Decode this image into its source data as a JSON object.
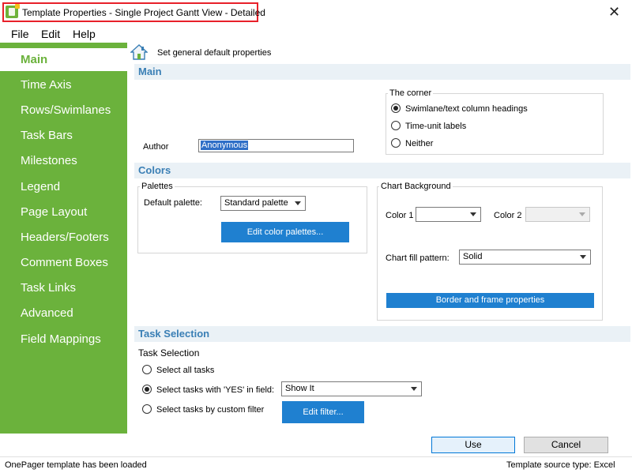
{
  "window": {
    "title": "Template Properties - Single Project Gantt View - Detailed",
    "close_glyph": "✕"
  },
  "menu": [
    "File",
    "Edit",
    "Help"
  ],
  "sidebar": {
    "items": [
      {
        "label": "Main",
        "active": true
      },
      {
        "label": "Time Axis"
      },
      {
        "label": "Rows/Swimlanes"
      },
      {
        "label": "Task Bars"
      },
      {
        "label": "Milestones"
      },
      {
        "label": "Legend"
      },
      {
        "label": "Page Layout"
      },
      {
        "label": "Headers/Footers"
      },
      {
        "label": "Comment Boxes"
      },
      {
        "label": "Task Links"
      },
      {
        "label": "Advanced"
      },
      {
        "label": "Field Mappings"
      }
    ]
  },
  "page_header": {
    "icon": "home-icon",
    "text": "Set general default properties"
  },
  "main_section": {
    "title": "Main",
    "author_label": "Author",
    "author_value": "Anonymous",
    "corner": {
      "title": "The corner",
      "options": [
        {
          "label": "Swimlane/text column headings",
          "checked": true
        },
        {
          "label": "Time-unit labels",
          "checked": false
        },
        {
          "label": "Neither",
          "checked": false
        }
      ]
    }
  },
  "colors_section": {
    "title": "Colors",
    "palettes": {
      "title": "Palettes",
      "default_palette_label": "Default palette:",
      "default_palette_value": "Standard palette",
      "edit_button": "Edit color palettes..."
    },
    "chart_background": {
      "title": "Chart Background",
      "color1_label": "Color 1",
      "color2_label": "Color 2",
      "fill_pattern_label": "Chart fill pattern:",
      "fill_pattern_value": "Solid",
      "border_button": "Border and frame properties"
    }
  },
  "task_selection_section": {
    "title": "Task Selection",
    "subtitle": "Task Selection",
    "options": [
      {
        "label": "Select all tasks",
        "checked": false
      },
      {
        "label": "Select tasks with 'YES' in field:",
        "checked": true
      },
      {
        "label": "Select tasks by custom filter",
        "checked": false
      }
    ],
    "field_value": "Show It",
    "edit_filter_button": "Edit filter..."
  },
  "footer": {
    "use_button": "Use",
    "cancel_button": "Cancel"
  },
  "status": {
    "left": "OnePager template has been loaded",
    "right": "Template source type: Excel"
  },
  "colors": {
    "sidebar_green": "#6bb23c",
    "section_blue": "#3a7fb5",
    "button_blue": "#1f80d0",
    "title_highlight": "#e8202a"
  }
}
